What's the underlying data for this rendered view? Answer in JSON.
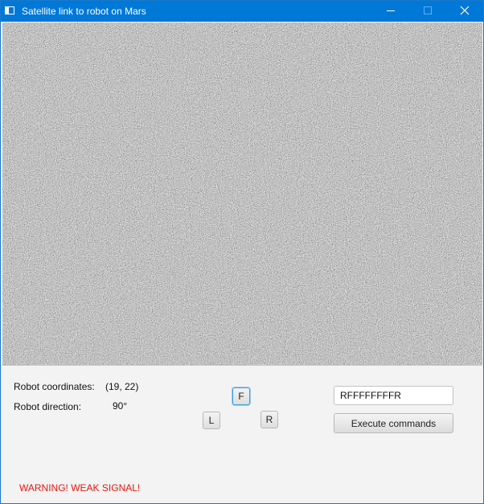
{
  "window": {
    "title": "Satellite link to robot on Mars",
    "titlebar_color": "#0078d7",
    "controls": [
      "minimize-icon",
      "maximize-icon",
      "close-icon"
    ]
  },
  "screen": {
    "content": "static-noise"
  },
  "status": {
    "coords_label": "Robot coordinates:",
    "coords_value": "(19, 22)",
    "direction_label": "Robot direction:",
    "direction_value": "90°"
  },
  "controls": {
    "forward_label": "F",
    "left_label": "L",
    "right_label": "R"
  },
  "command": {
    "input_value": "RFFFFFFFFR",
    "execute_label": "Execute commands"
  },
  "warning": {
    "text": "WARNING! WEAK SIGNAL!",
    "color": "#e8160c"
  }
}
